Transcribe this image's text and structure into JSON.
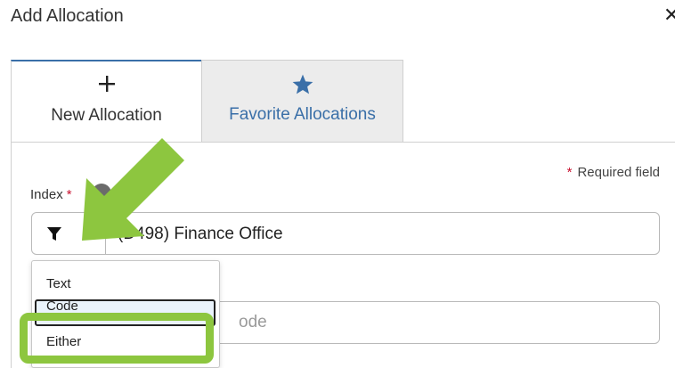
{
  "dialog": {
    "title": "Add Allocation",
    "close_icon": "close-icon"
  },
  "tabs": [
    {
      "label": "New Allocation",
      "icon": "plus-icon",
      "active": true
    },
    {
      "label": "Favorite Allocations",
      "icon": "star-icon",
      "active": false
    }
  ],
  "form": {
    "required_note": "Required field",
    "required_marker": "*",
    "index": {
      "label": "Index",
      "value": "(D498) Finance Office",
      "filter_icon": "filter-icon",
      "dropdown_icon": "caret-down-icon"
    },
    "second_input": {
      "visible_text": "ode"
    },
    "search_mode_menu": {
      "options": [
        "Text",
        "Code",
        "Either"
      ],
      "focused": "Code"
    }
  },
  "annotation": {
    "arrow_color": "#8dc63f",
    "highlight_color": "#8dc63f"
  },
  "colors": {
    "accent_blue": "#3a6fa8",
    "required_red": "#c8102e",
    "tab_inactive_bg": "#ececec"
  }
}
